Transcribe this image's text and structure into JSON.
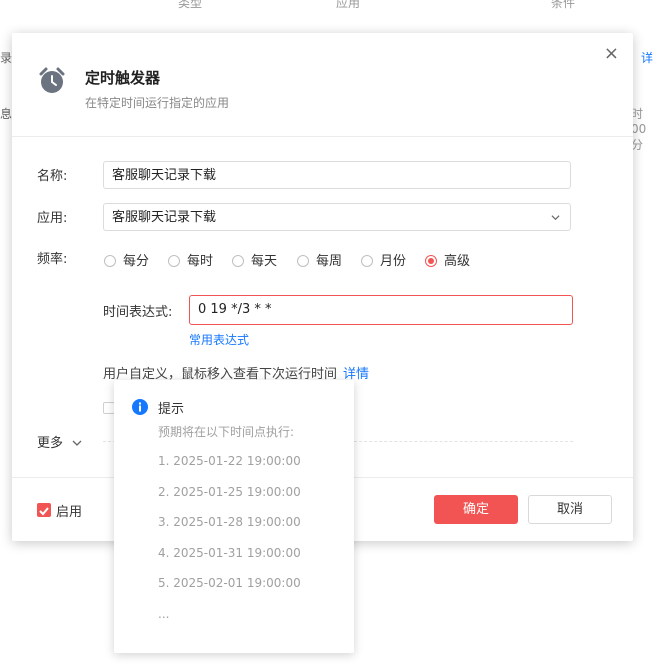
{
  "background": {
    "col_type": "类型",
    "col_app": "应用",
    "col_condition": "条件",
    "left_clip_1": "录",
    "left_clip_2": "息",
    "right_link": "详",
    "right_clip": "时00分"
  },
  "dialog": {
    "title": "定时触发器",
    "subtitle": "在特定时间运行指定的应用",
    "close": "×",
    "name_label": "名称:",
    "name_value": "客服聊天记录下载",
    "app_label": "应用:",
    "app_value": "客服聊天记录下载",
    "freq_label": "频率:",
    "freq_options": [
      "每分",
      "每时",
      "每天",
      "每周",
      "月份",
      "高级"
    ],
    "freq_selected": "高级",
    "cron_label": "时间表达式:",
    "cron_value": "0 19 */3 * *",
    "common_expr_link": "常用表达式",
    "hint_text": "用户自定义，鼠标移入查看下次运行时间",
    "hint_detail_link": "详情",
    "more_label": "更多",
    "enable_label": "启用",
    "enable_checked": true,
    "ok_label": "确定",
    "cancel_label": "取消"
  },
  "popover": {
    "title": "提示",
    "desc": "预期将在以下时间点执行:",
    "items": [
      "1. 2025-01-22 19:00:00",
      "2. 2025-01-25 19:00:00",
      "3. 2025-01-28 19:00:00",
      "4. 2025-01-31 19:00:00",
      "5. 2025-02-01 19:00:00",
      "..."
    ]
  },
  "colors": {
    "accent": "#f25454",
    "link": "#1677ff",
    "info": "#1677ff"
  }
}
